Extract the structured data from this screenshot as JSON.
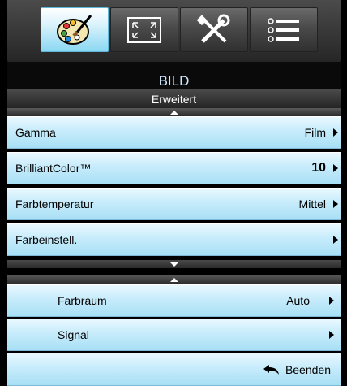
{
  "tabs": [
    {
      "icon": "palette-icon",
      "active": true
    },
    {
      "icon": "screen-resize-icon",
      "active": false
    },
    {
      "icon": "tools-icon",
      "active": false
    },
    {
      "icon": "list-icon",
      "active": false
    }
  ],
  "title": "BILD",
  "section": "Erweitert",
  "rows": [
    {
      "label": "Gamma",
      "value": "Film",
      "arrow": true
    },
    {
      "label": "BrilliantColor™",
      "value": "10",
      "arrow": true
    },
    {
      "label": "Farbtemperatur",
      "value": "Mittel",
      "arrow": true
    },
    {
      "label": "Farbeinstell.",
      "value": "",
      "arrow": true
    }
  ],
  "sub_rows": [
    {
      "label": "Farbraum",
      "value": "Auto",
      "arrow": true
    },
    {
      "label": "Signal",
      "value": "",
      "arrow": true
    }
  ],
  "exit_label": "Beenden",
  "colors": {
    "active_tab": "#8ad7f2",
    "row": "#c7ecfb",
    "title_text": "#cfe8ff"
  }
}
